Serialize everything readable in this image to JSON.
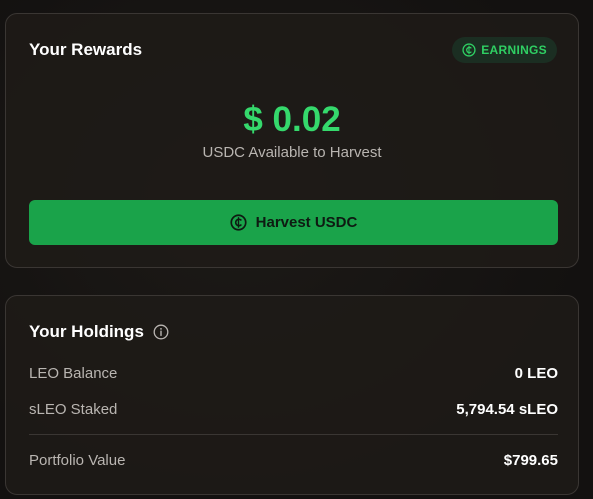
{
  "rewards": {
    "title": "Your Rewards",
    "badge_label": "EARNINGS",
    "badge_icon": "usdc-coin-icon",
    "amount": "$ 0.02",
    "amount_subtitle": "USDC Available to Harvest",
    "harvest_button_label": "Harvest USDC",
    "harvest_button_icon": "usdc-coin-icon"
  },
  "holdings": {
    "title": "Your Holdings",
    "info_icon": "info-icon",
    "rows": [
      {
        "label": "LEO Balance",
        "value": "0 LEO"
      },
      {
        "label": "sLEO Staked",
        "value": "5,794.54 sLEO"
      },
      {
        "label": "Portfolio Value",
        "value": "$799.65"
      }
    ]
  },
  "colors": {
    "accent_green": "#35d96c",
    "button_green": "#1aa34a",
    "badge_bg": "#1b2e22",
    "background": "#141210"
  }
}
